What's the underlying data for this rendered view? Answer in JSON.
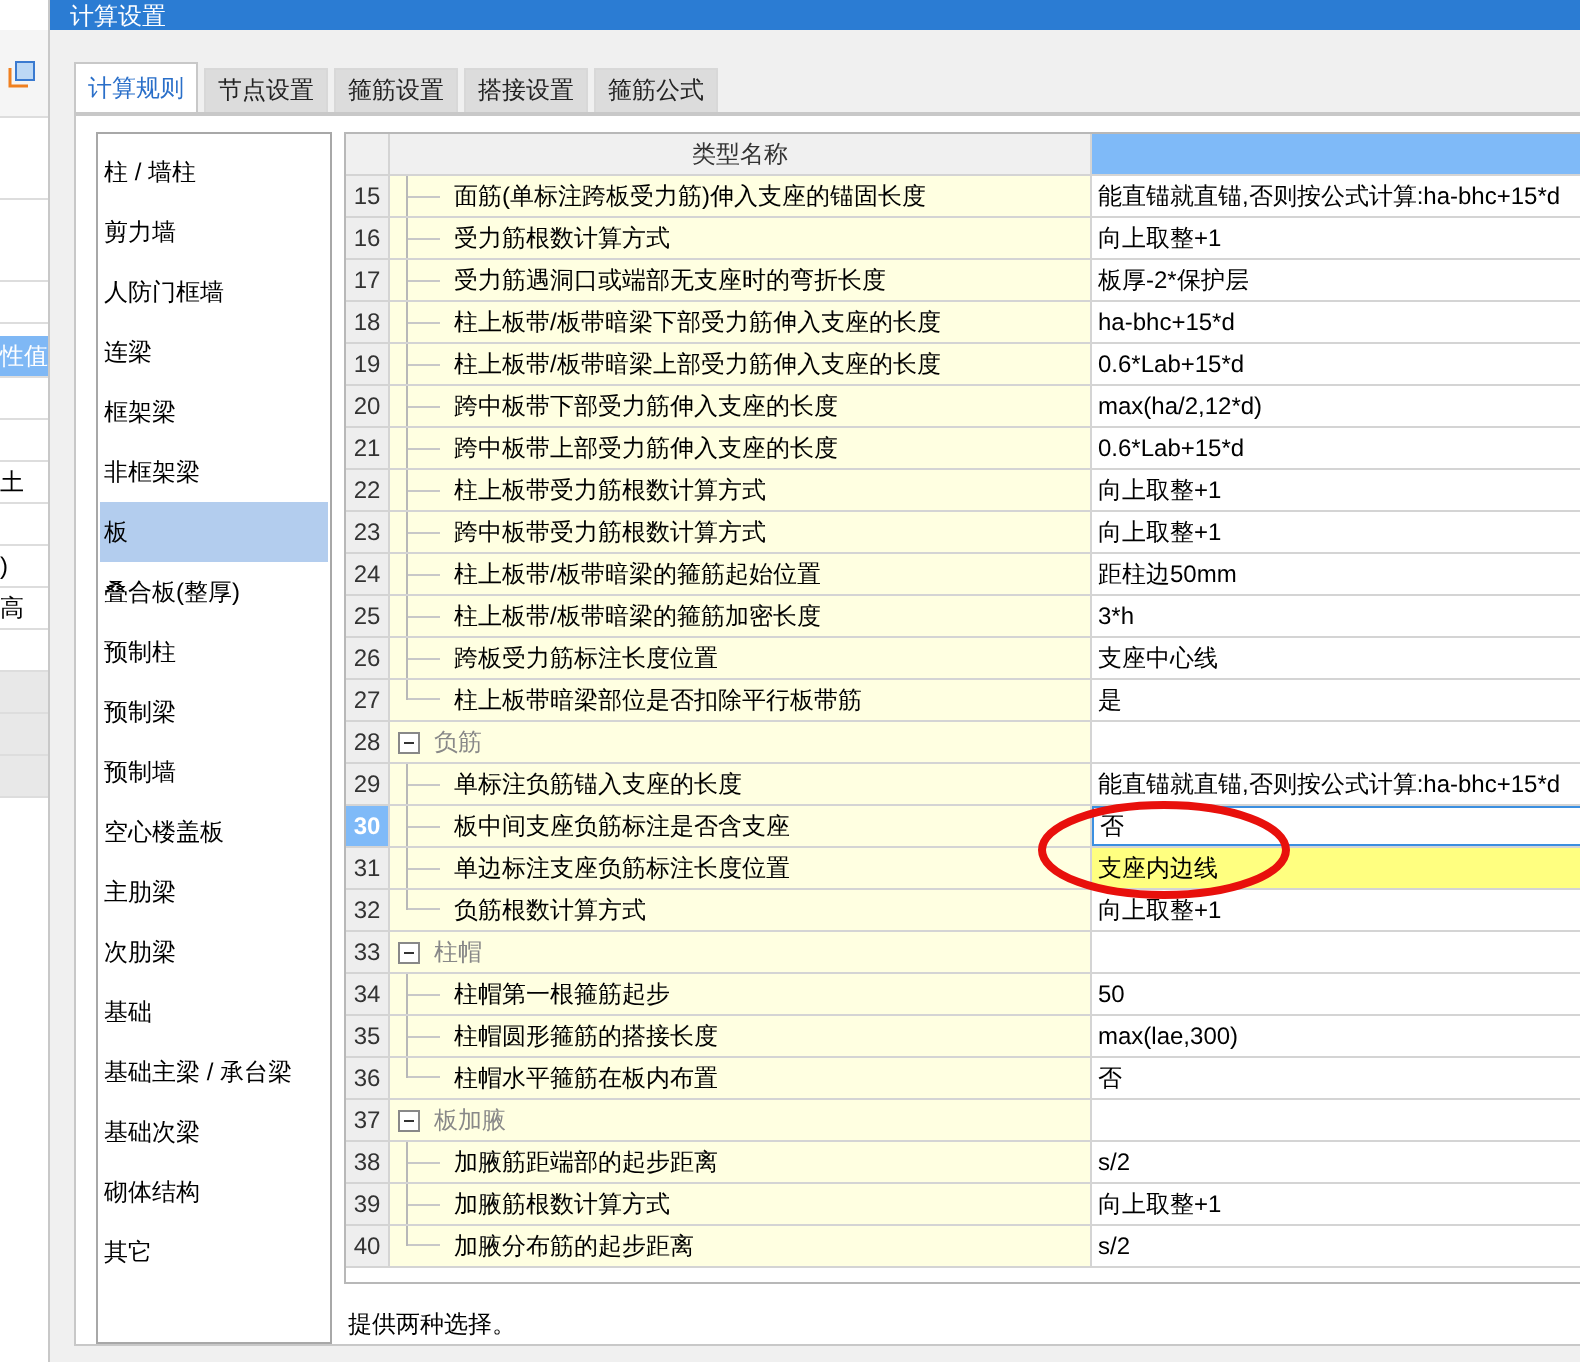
{
  "background_window": {
    "cells": [
      {
        "kind": "blank"
      },
      {
        "kind": "blank"
      },
      {
        "kind": "blank"
      },
      {
        "kind": "header",
        "text": "性值"
      },
      {
        "kind": "blank"
      },
      {
        "kind": "blank"
      },
      {
        "kind": "cell",
        "text": "土"
      },
      {
        "kind": "blank"
      },
      {
        "kind": "cell",
        "text": ")"
      },
      {
        "kind": "cell",
        "text": "高"
      },
      {
        "kind": "blank"
      },
      {
        "kind": "grey"
      },
      {
        "kind": "grey"
      },
      {
        "kind": "grey"
      }
    ]
  },
  "window": {
    "title": "计算设置"
  },
  "tabs": [
    {
      "label": "计算规则",
      "selected": true
    },
    {
      "label": "节点设置",
      "selected": false
    },
    {
      "label": "箍筋设置",
      "selected": false
    },
    {
      "label": "搭接设置",
      "selected": false
    },
    {
      "label": "箍筋公式",
      "selected": false
    }
  ],
  "sidebar": {
    "items": [
      {
        "label": "柱 / 墙柱",
        "selected": false
      },
      {
        "label": "剪力墙",
        "selected": false
      },
      {
        "label": "人防门框墙",
        "selected": false
      },
      {
        "label": "连梁",
        "selected": false
      },
      {
        "label": "框架梁",
        "selected": false
      },
      {
        "label": "非框架梁",
        "selected": false
      },
      {
        "label": "板",
        "selected": true
      },
      {
        "label": "叠合板(整厚)",
        "selected": false
      },
      {
        "label": "预制柱",
        "selected": false
      },
      {
        "label": "预制梁",
        "selected": false
      },
      {
        "label": "预制墙",
        "selected": false
      },
      {
        "label": "空心楼盖板",
        "selected": false
      },
      {
        "label": "主肋梁",
        "selected": false
      },
      {
        "label": "次肋梁",
        "selected": false
      },
      {
        "label": "基础",
        "selected": false
      },
      {
        "label": "基础主梁 / 承台梁",
        "selected": false
      },
      {
        "label": "基础次梁",
        "selected": false
      },
      {
        "label": "砌体结构",
        "selected": false
      },
      {
        "label": "其它",
        "selected": false
      }
    ]
  },
  "table": {
    "columns": [
      {
        "label": "类型名称",
        "selected": false
      },
      {
        "selected": true
      }
    ],
    "rows": [
      {
        "kind": "item",
        "num": "15",
        "name": "面筋(单标注跨板受力筋)伸入支座的锚固长度",
        "value": "能直锚就直锚,否则按公式计算:ha-bhc+15*d",
        "selected": false,
        "highlighted": false
      },
      {
        "kind": "item",
        "num": "16",
        "name": "受力筋根数计算方式",
        "value": "向上取整+1",
        "selected": false,
        "highlighted": false
      },
      {
        "kind": "item",
        "num": "17",
        "name": "受力筋遇洞口或端部无支座时的弯折长度",
        "value": "板厚-2*保护层",
        "selected": false,
        "highlighted": false
      },
      {
        "kind": "item",
        "num": "18",
        "name": "柱上板带/板带暗梁下部受力筋伸入支座的长度",
        "value": "ha-bhc+15*d",
        "selected": false,
        "highlighted": false
      },
      {
        "kind": "item",
        "num": "19",
        "name": "柱上板带/板带暗梁上部受力筋伸入支座的长度",
        "value": "0.6*Lab+15*d",
        "selected": false,
        "highlighted": false
      },
      {
        "kind": "item",
        "num": "20",
        "name": "跨中板带下部受力筋伸入支座的长度",
        "value": "max(ha/2,12*d)",
        "selected": false,
        "highlighted": false
      },
      {
        "kind": "item",
        "num": "21",
        "name": "跨中板带上部受力筋伸入支座的长度",
        "value": "0.6*Lab+15*d",
        "selected": false,
        "highlighted": false
      },
      {
        "kind": "item",
        "num": "22",
        "name": "柱上板带受力筋根数计算方式",
        "value": "向上取整+1",
        "selected": false,
        "highlighted": false
      },
      {
        "kind": "item",
        "num": "23",
        "name": "跨中板带受力筋根数计算方式",
        "value": "向上取整+1",
        "selected": false,
        "highlighted": false
      },
      {
        "kind": "item",
        "num": "24",
        "name": "柱上板带/板带暗梁的箍筋起始位置",
        "value": "距柱边50mm",
        "selected": false,
        "highlighted": false
      },
      {
        "kind": "item",
        "num": "25",
        "name": "柱上板带/板带暗梁的箍筋加密长度",
        "value": "3*h",
        "selected": false,
        "highlighted": false
      },
      {
        "kind": "item",
        "num": "26",
        "name": "跨板受力筋标注长度位置",
        "value": "支座中心线",
        "selected": false,
        "highlighted": false
      },
      {
        "kind": "item",
        "num": "27",
        "name": "柱上板带暗梁部位是否扣除平行板带筋",
        "value": "是",
        "selected": false,
        "highlighted": false
      },
      {
        "kind": "group",
        "num": "28",
        "name": "负筋",
        "expanded": true,
        "selected": false,
        "children": [
          {
            "kind": "item",
            "num": "29",
            "name": "单标注负筋锚入支座的长度",
            "value": "能直锚就直锚,否则按公式计算:ha-bhc+15*d",
            "selected": false,
            "highlighted": false
          },
          {
            "kind": "item",
            "num": "30",
            "name": "板中间支座负筋标注是否含支座",
            "value": "否",
            "selected": true,
            "highlighted": false
          },
          {
            "kind": "item",
            "num": "31",
            "name": "单边标注支座负筋标注长度位置",
            "value": "支座内边线",
            "selected": false,
            "highlighted": true
          },
          {
            "kind": "item",
            "num": "32",
            "name": "负筋根数计算方式",
            "value": "向上取整+1",
            "selected": false,
            "highlighted": false
          }
        ]
      },
      {
        "kind": "group",
        "num": "33",
        "name": "柱帽",
        "expanded": true,
        "selected": false,
        "children": [
          {
            "kind": "item",
            "num": "34",
            "name": "柱帽第一根箍筋起步",
            "value": "50",
            "selected": false,
            "highlighted": false
          },
          {
            "kind": "item",
            "num": "35",
            "name": "柱帽圆形箍筋的搭接长度",
            "value": "max(lae,300)",
            "selected": false,
            "highlighted": false
          },
          {
            "kind": "item",
            "num": "36",
            "name": "柱帽水平箍筋在板内布置",
            "value": "否",
            "selected": false,
            "highlighted": false
          }
        ]
      },
      {
        "kind": "group",
        "num": "37",
        "name": "板加腋",
        "expanded": true,
        "selected": false,
        "children": [
          {
            "kind": "item",
            "num": "38",
            "name": "加腋筋距端部的起步距离",
            "value": "s/2",
            "selected": false,
            "highlighted": false
          },
          {
            "kind": "item",
            "num": "39",
            "name": "加腋筋根数计算方式",
            "value": "向上取整+1",
            "selected": false,
            "highlighted": false
          },
          {
            "kind": "item",
            "num": "40",
            "name": "加腋分布筋的起步距离",
            "value": "s/2",
            "selected": false,
            "highlighted": false
          }
        ]
      }
    ]
  },
  "description": "提供两种选择。"
}
